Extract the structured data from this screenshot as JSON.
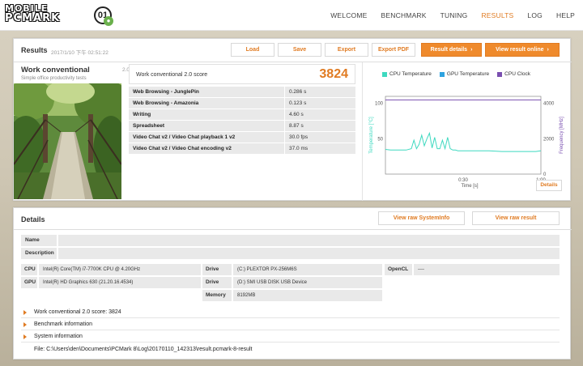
{
  "logo": {
    "line1": "MOBILE",
    "line2": "PCMARK",
    "badge": "01"
  },
  "nav": [
    "WELCOME",
    "BENCHMARK",
    "TUNING",
    "RESULTS",
    "LOG",
    "HELP"
  ],
  "nav_active": "RESULTS",
  "results": {
    "title": "Results",
    "date": "2017/1/10 下午 02:51:22",
    "buttons": {
      "load": "Load",
      "save": "Save",
      "export": "Export",
      "export_pdf": "Export PDF",
      "result_details": "Result details",
      "view_online": "View result online"
    },
    "test_name": "Work conventional",
    "test_version": "2.0",
    "test_sub": "Simple office productivity tests",
    "score_label": "Work conventional 2.0 score",
    "score_value": "3824",
    "subscores": [
      {
        "k": "Web Browsing - JunglePin",
        "v": "0.286 s"
      },
      {
        "k": "Web Browsing - Amazonia",
        "v": "0.123 s"
      },
      {
        "k": "Writing",
        "v": "4.60 s"
      },
      {
        "k": "Spreadsheet",
        "v": "8.87 s"
      },
      {
        "k": "Video Chat v2 / Video Chat playback 1 v2",
        "v": "30.0 fps"
      },
      {
        "k": "Video Chat v2 / Video Chat encoding v2",
        "v": "37.0 ms"
      }
    ],
    "details_button": "Details"
  },
  "chart_data": {
    "type": "line",
    "legend": [
      "CPU Temperature",
      "GPU Temperature",
      "CPU Clock"
    ],
    "colors": {
      "cpu_temp": "#3fd9c0",
      "gpu_temp": "#2ea3e0",
      "cpu_clock": "#7a4fb0"
    },
    "xlabel": "Time [s]",
    "ylabel_left": "Temperature [°C]",
    "ylabel_right": "Frequency [MHz]",
    "x_ticks": [
      "0:30",
      "1:00"
    ],
    "y_left_ticks": [
      "100",
      "50"
    ],
    "y_right_ticks": [
      "4000",
      "2000",
      "0"
    ],
    "xlim": [
      0,
      60
    ],
    "ylim_left": [
      0,
      110
    ],
    "ylim_right": [
      0,
      4400
    ],
    "series": [
      {
        "name": "CPU Temperature",
        "axis": "left",
        "x": [
          0,
          2,
          4,
          6,
          8,
          10,
          11,
          12,
          13,
          14,
          15,
          16,
          17,
          18,
          19,
          20,
          21,
          22,
          23,
          24,
          25,
          26,
          27,
          28,
          30,
          35,
          40,
          45,
          50,
          55,
          58,
          60
        ],
        "y": [
          35,
          34,
          34,
          34,
          34,
          36,
          48,
          36,
          42,
          55,
          40,
          50,
          58,
          37,
          52,
          36,
          36,
          48,
          36,
          52,
          36,
          34,
          34,
          33,
          33,
          33,
          33,
          32,
          32,
          32,
          32,
          33
        ]
      },
      {
        "name": "CPU Clock",
        "axis": "right",
        "x": [
          0,
          60
        ],
        "y": [
          4200,
          4200
        ]
      }
    ]
  },
  "details": {
    "title": "Details",
    "btn_sysinfo": "View raw SystemInfo",
    "btn_result": "View raw result",
    "name_label": "Name",
    "name_value": "",
    "desc_label": "Description",
    "desc_value": "",
    "cpu_label": "CPU",
    "cpu_value": "Intel(R) Core(TM) i7-7700K CPU @ 4.20GHz",
    "gpu_label": "GPU",
    "gpu_value": "Intel(R) HD Graphics 630 (21.20.16.4534)",
    "drive_label": "Drive",
    "drive1_value": "(C:) PLEXTOR PX-256M6S",
    "drive2_value": "(D:) SMI USB DISK USB Device",
    "memory_label": "Memory",
    "memory_value": "8192MB",
    "opencl_label": "OpenCL",
    "opencl_value": "----",
    "rows": [
      "Work conventional 2.0 score: 3824",
      "Benchmark information",
      "System information"
    ],
    "file": "File: C:\\Users\\den\\Documents\\PCMark 8\\Log\\20170110_142313\\result.pcmark-8-result"
  }
}
